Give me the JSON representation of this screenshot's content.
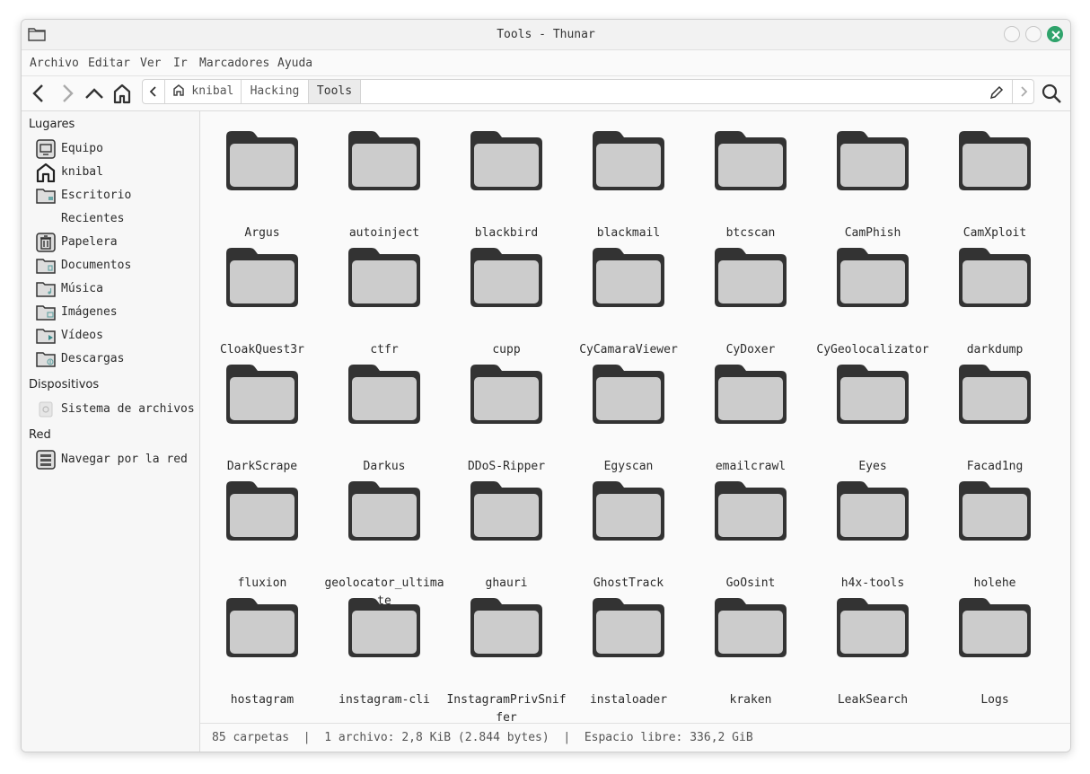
{
  "window": {
    "title": "Tools - Thunar"
  },
  "menu": [
    "Archivo",
    "Editar",
    "Ver",
    "Ir",
    "Marcadores",
    "Ayuda"
  ],
  "path": {
    "home": "knibal",
    "crumbs": [
      "Hacking",
      "Tools"
    ]
  },
  "sidebar": {
    "places_header": "Lugares",
    "places": [
      {
        "label": "Equipo",
        "icon": "computer-icon"
      },
      {
        "label": "knibal",
        "icon": "home-icon"
      },
      {
        "label": "Escritorio",
        "icon": "desktop-folder-icon"
      },
      {
        "label": "Recientes",
        "icon": "recent-icon"
      },
      {
        "label": "Papelera",
        "icon": "trash-icon"
      },
      {
        "label": "Documentos",
        "icon": "documents-folder-icon"
      },
      {
        "label": "Música",
        "icon": "music-folder-icon"
      },
      {
        "label": "Imágenes",
        "icon": "pictures-folder-icon"
      },
      {
        "label": "Vídeos",
        "icon": "videos-folder-icon"
      },
      {
        "label": "Descargas",
        "icon": "downloads-folder-icon"
      }
    ],
    "devices_header": "Dispositivos",
    "devices": [
      {
        "label": "Sistema de archivos",
        "icon": "drive-icon"
      }
    ],
    "network_header": "Red",
    "network": [
      {
        "label": "Navegar por la red",
        "icon": "network-icon"
      }
    ]
  },
  "folders": [
    "Argus",
    "autoinject",
    "blackbird",
    "blackmail",
    "btcscan",
    "CamPhish",
    "CamXploit",
    "CloakQuest3r",
    "ctfr",
    "cupp",
    "CyCamaraViewer",
    "CyDoxer",
    "CyGeolocalizator",
    "darkdump",
    "DarkScrape",
    "Darkus",
    "DDoS-Ripper",
    "Egyscan",
    "emailcrawl",
    "Eyes",
    "Facad1ng",
    "fluxion",
    "geolocator_ultimate",
    "ghauri",
    "GhostTrack",
    "GoOsint",
    "h4x-tools",
    "holehe",
    "hostagram",
    "instagram-cli",
    "InstagramPrivSniffer",
    "instaloader",
    "kraken",
    "LeakSearch",
    "Logs"
  ],
  "status": "85 carpetas  |  1 archivo: 2,8 KiB (2.844 bytes)  |  Espacio libre: 336,2 GiB",
  "colors": {
    "folder_dark": "#333333",
    "folder_light": "#cccccc",
    "close_button": "#2fa36b"
  }
}
